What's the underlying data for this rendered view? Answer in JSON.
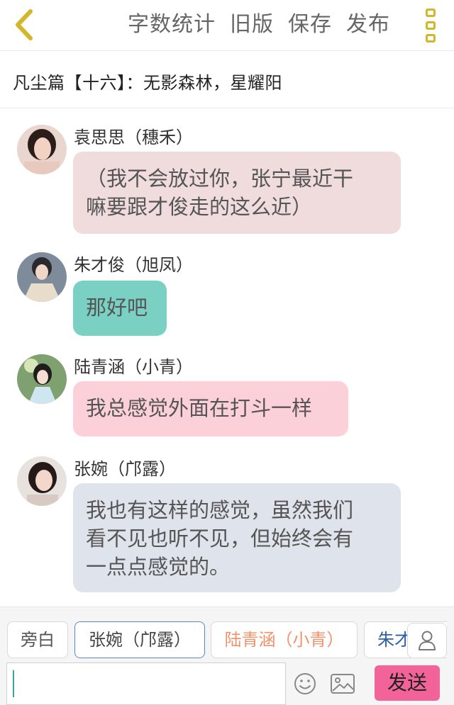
{
  "header": {
    "actions": [
      "字数统计",
      "旧版",
      "保存",
      "发布"
    ],
    "back_icon": "chevron-left-icon",
    "more_icon": "more-vertical-icon",
    "accent": "#d4b62a"
  },
  "chapter": {
    "title": "凡尘篇【十六】：无影森林，星耀阳"
  },
  "messages": [
    {
      "speaker": "袁思思（穗禾）",
      "text_lines": [
        "（我不会放过你，张宁最近干",
        "嘛要跟才俊走的这么近）"
      ],
      "bubble_color": "#f0dcdc"
    },
    {
      "speaker": "朱才俊（旭凤）",
      "text_lines": [
        "那好吧"
      ],
      "bubble_color": "#7ad0c2"
    },
    {
      "speaker": "陆青涵（小青）",
      "text_lines": [
        "我总感觉外面在打斗一样"
      ],
      "bubble_color": "#fcd0d9"
    },
    {
      "speaker": "张婉（邝露）",
      "text_lines": [
        "我也有这样的感觉，虽然我们",
        "看不见也听不见，但始终会有",
        "一点点感觉的。"
      ],
      "bubble_color": "#dfe4ec"
    }
  ],
  "roles": {
    "items": [
      "旁白",
      "张婉（邝露）",
      "陆青涵（小青）",
      "朱才俊（旭凤）"
    ],
    "selected": "张婉（邝露）"
  },
  "composer": {
    "input_value": "",
    "send_label": "发送",
    "send_color": "#f2639a",
    "emoji_icon": "smiley-icon",
    "image_icon": "image-icon",
    "user_icon": "user-icon"
  }
}
